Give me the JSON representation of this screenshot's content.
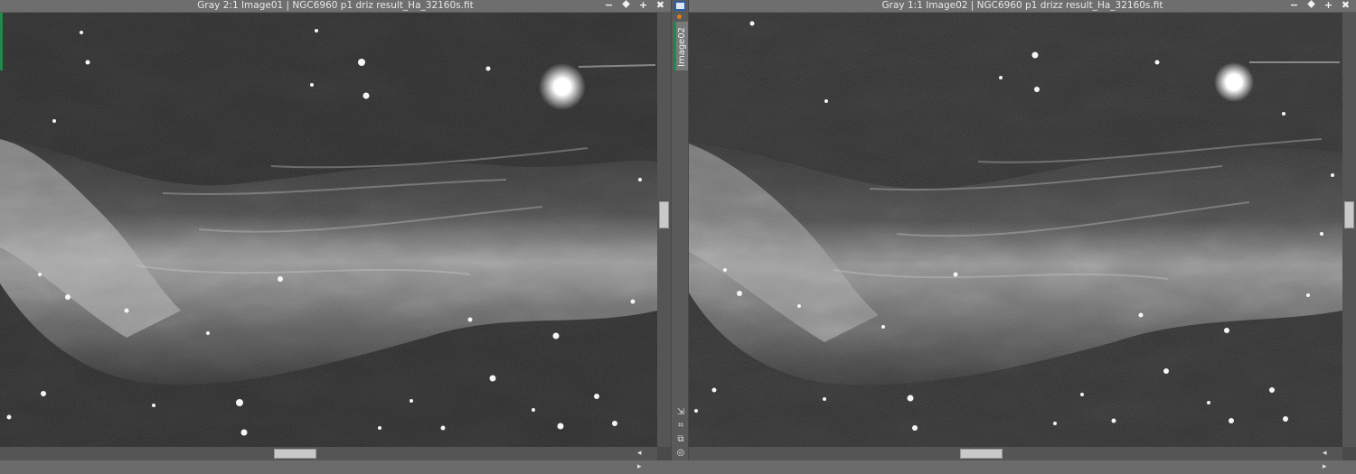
{
  "windows": [
    {
      "title": "Gray 2:1 Image01 | NGC6960 p1 driz result_Ha_32160s.fit",
      "controls": [
        "−",
        "⯁",
        "+",
        "✖"
      ]
    },
    {
      "title": "Gray 1:1 Image02 | NGC6960 p1 drizz result_Ha_32160s.fit",
      "controls": [
        "−",
        "⯁",
        "+",
        "✖"
      ]
    }
  ],
  "sidebar": {
    "tab_label": "Image02",
    "tools": [
      "⇲",
      "⌗",
      "⧉",
      "◎"
    ]
  },
  "scroll_arrows": "◂ ▸",
  "colors": {
    "titlebar": "#6e6e6e",
    "active_tab": "#1f8a4a",
    "accent": "#2d5fa8",
    "indicator": "#e07a1f"
  }
}
